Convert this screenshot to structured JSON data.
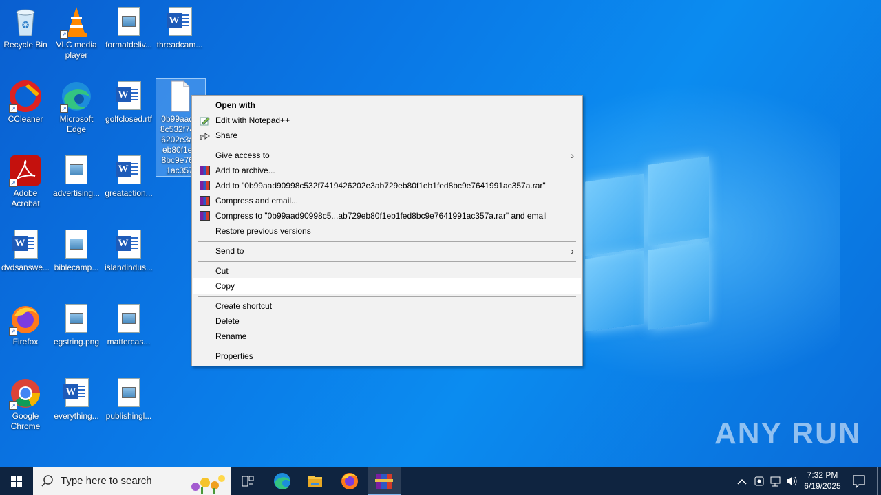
{
  "desktop": {
    "icons": [
      {
        "label": "Recycle Bin",
        "icon": "recycle-bin-icon"
      },
      {
        "label": "VLC media player",
        "icon": "vlc-icon"
      },
      {
        "label": "formatdeliv...",
        "icon": "image-file-icon"
      },
      {
        "label": "threadcam...",
        "icon": "word-file-icon"
      },
      {
        "label": "CCleaner",
        "icon": "ccleaner-icon"
      },
      {
        "label": "Microsoft Edge",
        "icon": "edge-icon"
      },
      {
        "label": "golfclosed.rtf",
        "icon": "word-file-icon"
      },
      {
        "label": "0b99aad90998c532f7419426202e3ab729eb80f1eb1fed8bc9e7641991ac357a",
        "icon": "generic-file-icon",
        "shown_text": "0b99aad9\n8c532f741\n6202e3ab\neb80f1eb\n8bc9e764\n1ac357"
      },
      {
        "label": "Adobe Acrobat",
        "icon": "acrobat-icon"
      },
      {
        "label": "advertising...",
        "icon": "image-file-icon"
      },
      {
        "label": "greataction...",
        "icon": "word-file-icon"
      },
      {
        "label": "dvdsanswe...",
        "icon": "word-file-icon"
      },
      {
        "label": "biblecamp...",
        "icon": "image-file-icon"
      },
      {
        "label": "islandindus...",
        "icon": "word-file-icon"
      },
      {
        "label": "Firefox",
        "icon": "firefox-icon"
      },
      {
        "label": "egstring.png",
        "icon": "image-file-icon"
      },
      {
        "label": "mattercas...",
        "icon": "image-file-icon"
      },
      {
        "label": "Google Chrome",
        "icon": "chrome-icon"
      },
      {
        "label": "everything...",
        "icon": "word-file-icon"
      },
      {
        "label": "publishingl...",
        "icon": "image-file-icon"
      }
    ]
  },
  "context_menu": {
    "items": [
      {
        "label": "Open with"
      },
      {
        "label": "Edit with Notepad++"
      },
      {
        "label": "Share"
      },
      {
        "label": "Give access to"
      },
      {
        "label": "Add to archive..."
      },
      {
        "label": "Add to \"0b99aad90998c532f7419426202e3ab729eb80f1eb1fed8bc9e7641991ac357a.rar\""
      },
      {
        "label": "Compress and email..."
      },
      {
        "label": "Compress to \"0b99aad90998c5...ab729eb80f1eb1fed8bc9e7641991ac357a.rar\" and email"
      },
      {
        "label": "Restore previous versions"
      },
      {
        "label": "Send to"
      },
      {
        "label": "Cut"
      },
      {
        "label": "Copy"
      },
      {
        "label": "Create shortcut"
      },
      {
        "label": "Delete"
      },
      {
        "label": "Rename"
      },
      {
        "label": "Properties"
      }
    ],
    "hovered_item": "Copy"
  },
  "taskbar": {
    "search_placeholder": "Type here to search",
    "time": "7:32 PM",
    "date": "6/19/2025",
    "pinned": [
      "task-view-icon",
      "edge-icon",
      "file-explorer-icon",
      "firefox-icon",
      "winrar-icon"
    ]
  },
  "watermark": "ANY RUN"
}
